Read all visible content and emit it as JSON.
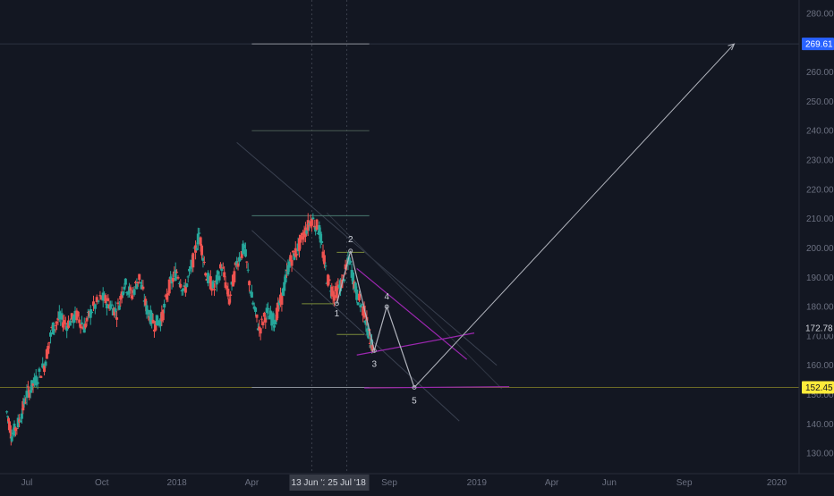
{
  "chart_data": {
    "type": "candlestick",
    "title": "",
    "ylim": [
      128,
      285
    ],
    "y_ticks": [
      130,
      140,
      150,
      160,
      170,
      180,
      190,
      200,
      210,
      220,
      230,
      240,
      250,
      260,
      270,
      280
    ],
    "x_ticks": [
      {
        "label": "Jul",
        "t": 0
      },
      {
        "label": "Oct",
        "t": 3
      },
      {
        "label": "2018",
        "t": 6
      },
      {
        "label": "Apr",
        "t": 9
      },
      {
        "label": "Sep",
        "t": 14.5
      },
      {
        "label": "2019",
        "t": 18
      },
      {
        "label": "Apr",
        "t": 21
      },
      {
        "label": "Jun",
        "t": 23.3
      },
      {
        "label": "Sep",
        "t": 26.3
      },
      {
        "label": "2020",
        "t": 30
      }
    ],
    "crosshair_labels": [
      {
        "label": "13 Jun '18",
        "t": 11.4
      },
      {
        "label": "25 Jul '18",
        "t": 12.8
      }
    ],
    "price_labels": [
      {
        "value": 269.61,
        "text": "269.61",
        "style": "blue"
      },
      {
        "value": 172.78,
        "text": "172.78",
        "style": "dark"
      },
      {
        "value": 152.45,
        "text": "152.45",
        "style": "yellow"
      }
    ],
    "price_path": [
      [
        -0.8,
        144
      ],
      [
        -0.6,
        136
      ],
      [
        -0.3,
        141
      ],
      [
        0.0,
        150
      ],
      [
        0.3,
        154
      ],
      [
        0.7,
        160
      ],
      [
        1.0,
        172
      ],
      [
        1.3,
        176
      ],
      [
        1.6,
        174
      ],
      [
        2.0,
        177
      ],
      [
        2.3,
        173
      ],
      [
        2.6,
        179
      ],
      [
        3.0,
        183
      ],
      [
        3.3,
        181
      ],
      [
        3.6,
        178
      ],
      [
        3.9,
        188
      ],
      [
        4.2,
        184
      ],
      [
        4.5,
        190
      ],
      [
        4.8,
        179
      ],
      [
        5.1,
        174
      ],
      [
        5.4,
        176
      ],
      [
        5.7,
        187
      ],
      [
        6.0,
        192
      ],
      [
        6.3,
        185
      ],
      [
        6.6,
        194
      ],
      [
        6.9,
        205
      ],
      [
        7.2,
        190
      ],
      [
        7.5,
        186
      ],
      [
        7.8,
        194
      ],
      [
        8.1,
        182
      ],
      [
        8.4,
        195
      ],
      [
        8.7,
        200
      ],
      [
        9.0,
        183
      ],
      [
        9.3,
        172
      ],
      [
        9.6,
        178
      ],
      [
        9.9,
        175
      ],
      [
        10.2,
        183
      ],
      [
        10.5,
        195
      ],
      [
        10.8,
        199
      ],
      [
        11.1,
        205
      ],
      [
        11.4,
        210
      ],
      [
        11.7,
        206
      ],
      [
        12.0,
        190
      ],
      [
        12.3,
        184
      ],
      [
        12.6,
        188
      ],
      [
        12.9,
        196
      ],
      [
        13.2,
        184
      ],
      [
        13.5,
        178
      ],
      [
        13.7,
        170
      ],
      [
        13.85,
        165
      ]
    ],
    "wave_points": [
      {
        "label": "1",
        "t": 12.4,
        "value": 181
      },
      {
        "label": "2",
        "t": 12.95,
        "value": 199
      },
      {
        "label": "3",
        "t": 13.9,
        "value": 165
      },
      {
        "label": "4",
        "t": 14.4,
        "value": 180
      },
      {
        "label": "5",
        "t": 15.5,
        "value": 152.45
      }
    ],
    "target": {
      "t": 28.3,
      "value": 269.61
    },
    "horizontal_levels": [
      {
        "value": 269.61,
        "t0": 9.0,
        "t1": 13.7,
        "color": "#8a8f98"
      },
      {
        "value": 240,
        "t0": 9.0,
        "t1": 13.7,
        "color": "#4a5a52"
      },
      {
        "value": 211,
        "t0": 9.0,
        "t1": 13.7,
        "color": "#4a7a70"
      },
      {
        "value": 198.5,
        "t0": 12.4,
        "t1": 13.5,
        "color": "#7a8a3a"
      },
      {
        "value": 181,
        "t0": 11.0,
        "t1": 12.3,
        "color": "#7a8a3a"
      },
      {
        "value": 170.5,
        "t0": 12.4,
        "t1": 13.5,
        "color": "#7a8a3a"
      },
      {
        "value": 152.45,
        "t0": 9.0,
        "t1": 13.7,
        "color": "#8a8f98"
      }
    ],
    "channel_lines": [
      {
        "p1": [
          13.2,
          193
        ],
        "p2": [
          17.6,
          162
        ],
        "color": "#9c27b0"
      },
      {
        "p1": [
          13.2,
          163.5
        ],
        "p2": [
          17.9,
          171
        ],
        "color": "#9c27b0"
      },
      {
        "p1": [
          13.5,
          152.3
        ],
        "p2": [
          19.3,
          152.7
        ],
        "color": "#9c27b0"
      }
    ],
    "guide_lines": [
      {
        "p1": [
          8.4,
          236
        ],
        "p2": [
          18.8,
          160
        ],
        "color": "#3a4150"
      },
      {
        "p1": [
          9.0,
          206
        ],
        "p2": [
          17.3,
          141
        ],
        "color": "#3a4150"
      },
      {
        "p1": [
          12.0,
          212
        ],
        "p2": [
          19.0,
          152
        ],
        "color": "#2f3542"
      }
    ],
    "grid": false,
    "colors": {
      "background": "#131722",
      "up": "#26a69a",
      "down": "#ef5350",
      "axis_text": "#6b7080",
      "wave": "#b2b5be",
      "blue_label": "#2962ff",
      "yellow_label": "#ffeb3b",
      "yellow_line": "#6d6b26"
    }
  }
}
